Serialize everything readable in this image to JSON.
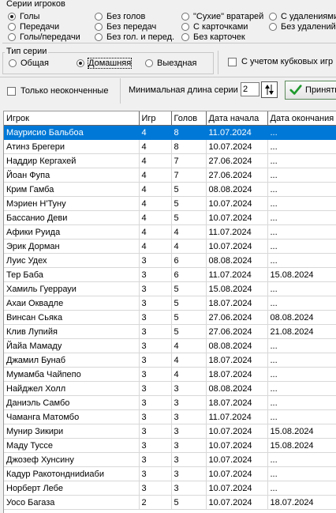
{
  "player_series": {
    "legend": "Серии игроков",
    "options": [
      {
        "label": "Голы",
        "selected": true
      },
      {
        "label": "Передачи",
        "selected": false
      },
      {
        "label": "Голы/передачи",
        "selected": false
      },
      {
        "label": "Без голов",
        "selected": false
      },
      {
        "label": "Без передач",
        "selected": false
      },
      {
        "label": "Без гол. и перед.",
        "selected": false
      },
      {
        "label": "\"Сухие\" вратарей",
        "selected": false
      },
      {
        "label": "С карточками",
        "selected": false
      },
      {
        "label": "Без карточек",
        "selected": false
      },
      {
        "label": "С удалениями",
        "selected": false
      },
      {
        "label": "Без удалений",
        "selected": false
      }
    ]
  },
  "series_type": {
    "legend": "Тип серии",
    "options": [
      {
        "label": "Общая",
        "selected": false
      },
      {
        "label": "Домашняя",
        "selected": true
      },
      {
        "label": "Выездная",
        "selected": false
      }
    ]
  },
  "cup_games_checkbox": {
    "label": "С учетом кубковых игр",
    "checked": false
  },
  "unfinished_checkbox": {
    "label": "Только неоконченные",
    "checked": false
  },
  "min_length": {
    "label": "Минимальная длина серии",
    "value": "2"
  },
  "accept_button": {
    "label": "Принять"
  },
  "table": {
    "columns": [
      "Игрок",
      "Игр",
      "Голов",
      "Дата начала",
      "Дата окончания"
    ],
    "selected_row": 0,
    "rows": [
      [
        "Маурисио Бальбоа",
        "4",
        "8",
        "11.07.2024",
        "..."
      ],
      [
        "Атинз Брегери",
        "4",
        "8",
        "10.07.2024",
        "..."
      ],
      [
        "Наддир Кергахей",
        "4",
        "7",
        "27.06.2024",
        "..."
      ],
      [
        "Йоан Фупа",
        "4",
        "7",
        "27.06.2024",
        "..."
      ],
      [
        "Крим Гамба",
        "4",
        "5",
        "08.08.2024",
        "..."
      ],
      [
        "Мэриен Н'Туну",
        "4",
        "5",
        "10.07.2024",
        "..."
      ],
      [
        "Бассанио Деви",
        "4",
        "5",
        "10.07.2024",
        "..."
      ],
      [
        "Афики Руида",
        "4",
        "4",
        "11.07.2024",
        "..."
      ],
      [
        "Эрик Дорман",
        "4",
        "4",
        "10.07.2024",
        "..."
      ],
      [
        "Луис Удех",
        "3",
        "6",
        "08.08.2024",
        "..."
      ],
      [
        "Тер Баба",
        "3",
        "6",
        "11.07.2024",
        "15.08.2024"
      ],
      [
        "Хамиль Гуеррауи",
        "3",
        "5",
        "15.08.2024",
        "..."
      ],
      [
        "Ахаи Оквадле",
        "3",
        "5",
        "18.07.2024",
        "..."
      ],
      [
        "Винсан Сьяка",
        "3",
        "5",
        "27.06.2024",
        "08.08.2024"
      ],
      [
        "Клив Лупийя",
        "3",
        "5",
        "27.06.2024",
        "21.08.2024"
      ],
      [
        "Йайа Мамаду",
        "3",
        "4",
        "08.08.2024",
        "..."
      ],
      [
        "Джамил Бунаб",
        "3",
        "4",
        "18.07.2024",
        "..."
      ],
      [
        "Мумамба Чайпепо",
        "3",
        "4",
        "18.07.2024",
        "..."
      ],
      [
        "Найджел Холл",
        "3",
        "3",
        "08.08.2024",
        "..."
      ],
      [
        "Даниэль Самбо",
        "3",
        "3",
        "18.07.2024",
        "..."
      ],
      [
        "Чаманга Матомбо",
        "3",
        "3",
        "11.07.2024",
        "..."
      ],
      [
        "Мунир Зикири",
        "3",
        "3",
        "10.07.2024",
        "15.08.2024"
      ],
      [
        "Маду Туссе",
        "3",
        "3",
        "10.07.2024",
        "15.08.2024"
      ],
      [
        "Джозеф Хунсину",
        "3",
        "3",
        "10.07.2024",
        "..."
      ],
      [
        "Кадур Ракотондниdиаби",
        "3",
        "3",
        "10.07.2024",
        "..."
      ],
      [
        "Норберт Лебе",
        "3",
        "3",
        "10.07.2024",
        "..."
      ],
      [
        "Уосо Багаза",
        "2",
        "5",
        "10.07.2024",
        "18.07.2024"
      ]
    ]
  }
}
